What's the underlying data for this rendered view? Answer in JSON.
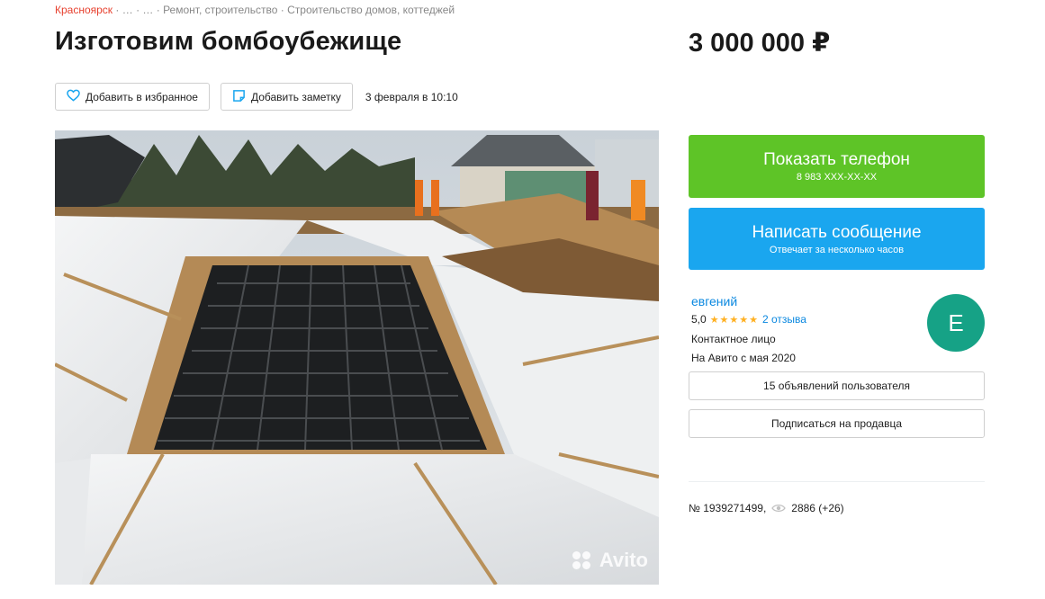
{
  "breadcrumb": {
    "city": "Красноярск",
    "sep": " · ",
    "ellipsis_1": "…",
    "ellipsis_2": "…",
    "category": "Ремонт, строительство",
    "subcategory": "Строительство домов, коттеджей"
  },
  "listing": {
    "title": "Изготовим бомбоубежище",
    "price": "3 000 000 ₽",
    "favorite_label": "Добавить в избранное",
    "note_label": "Добавить заметку",
    "date": "3 февраля в 10:10",
    "watermark": "Avito"
  },
  "contact": {
    "phone_button": "Показать телефон",
    "phone_masked": "8 983 XXX-XX-XX",
    "message_button": "Написать сообщение",
    "message_sub": "Отвечает за несколько часов"
  },
  "seller": {
    "name": "евгений",
    "rating": "5,0",
    "stars": "★★★★★",
    "reviews": "2 отзыва",
    "role": "Контактное лицо",
    "since": "На Авито с мая 2020",
    "avatar_letter": "Е",
    "listings_button": "15 объявлений пользователя",
    "subscribe_button": "Подписаться на продавца"
  },
  "stats": {
    "ad_number": "№ 1939271499,",
    "views": "2886 (+26)"
  },
  "colors": {
    "accent_red": "#e7412f",
    "phone_green": "#5ec427",
    "message_blue": "#1aa6ef",
    "link_blue": "#0a88e0",
    "avatar_teal": "#16a286",
    "star_gold": "#ffb021"
  },
  "icons": {
    "favorite": "heart-icon",
    "note": "note-icon",
    "views": "eye-icon"
  }
}
